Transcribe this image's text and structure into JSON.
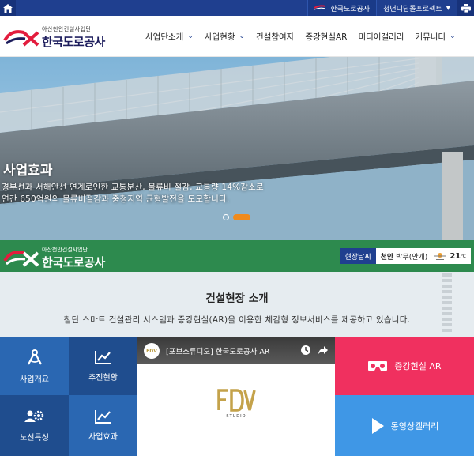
{
  "topbar": {
    "ex_link": "한국도로공사",
    "youth_link": "청년디딤돌프로젝트",
    "colors": {
      "bar": "#1f3f8f"
    }
  },
  "header": {
    "logo_sub": "아산천안건설사업단",
    "logo_main": "한국도로공사",
    "nav": [
      {
        "label": "사업단소개"
      },
      {
        "label": "사업현황"
      },
      {
        "label": "건설참여자"
      },
      {
        "label": "증강현실AR"
      },
      {
        "label": "미디어갤러리"
      },
      {
        "label": "커뮤니티"
      }
    ]
  },
  "hero": {
    "title": "사업효과",
    "desc_line1": "경부선과 서해안선 연계로인한 교통분산, 물류비 절감, 교통량 14%감소로",
    "desc_line2": "연간 650억원의 물류비절감과 중청지역 균형발전을 도모합니다.",
    "slides": 2,
    "active_slide": 2,
    "accent": "#f08a1c"
  },
  "band": {
    "logo_sub": "아산천안건설사업단",
    "logo_main": "한국도로공사",
    "weather_label": "현장날씨",
    "weather_place": "천안",
    "weather_state": "박무(안개)",
    "weather_temp": "21",
    "weather_unit": "℃",
    "color": "#2d8a4e"
  },
  "intro": {
    "title": "건설현장 소개",
    "desc": "첨단 스마트 건설관리 시스템과 증강현실(AR)을 이용한 체감형 정보서비스를 제공하고 있습니다."
  },
  "tiles": [
    {
      "label": "사업개요",
      "icon": "compass-icon"
    },
    {
      "label": "추진현황",
      "icon": "line-chart-icon"
    },
    {
      "label": "노선특성",
      "icon": "users-gear-icon"
    },
    {
      "label": "사업효과",
      "icon": "line-chart-icon"
    }
  ],
  "video": {
    "channel": "FDV",
    "title": "[포브스튜디오] 한국도로공사 AR",
    "brand": "FDV",
    "studio": "STUDIO"
  },
  "side": {
    "ar_label": "증강현실 AR",
    "gallery_label": "동영상갤러리",
    "ar_color": "#f0305f",
    "gallery_color": "#3f97e6"
  }
}
